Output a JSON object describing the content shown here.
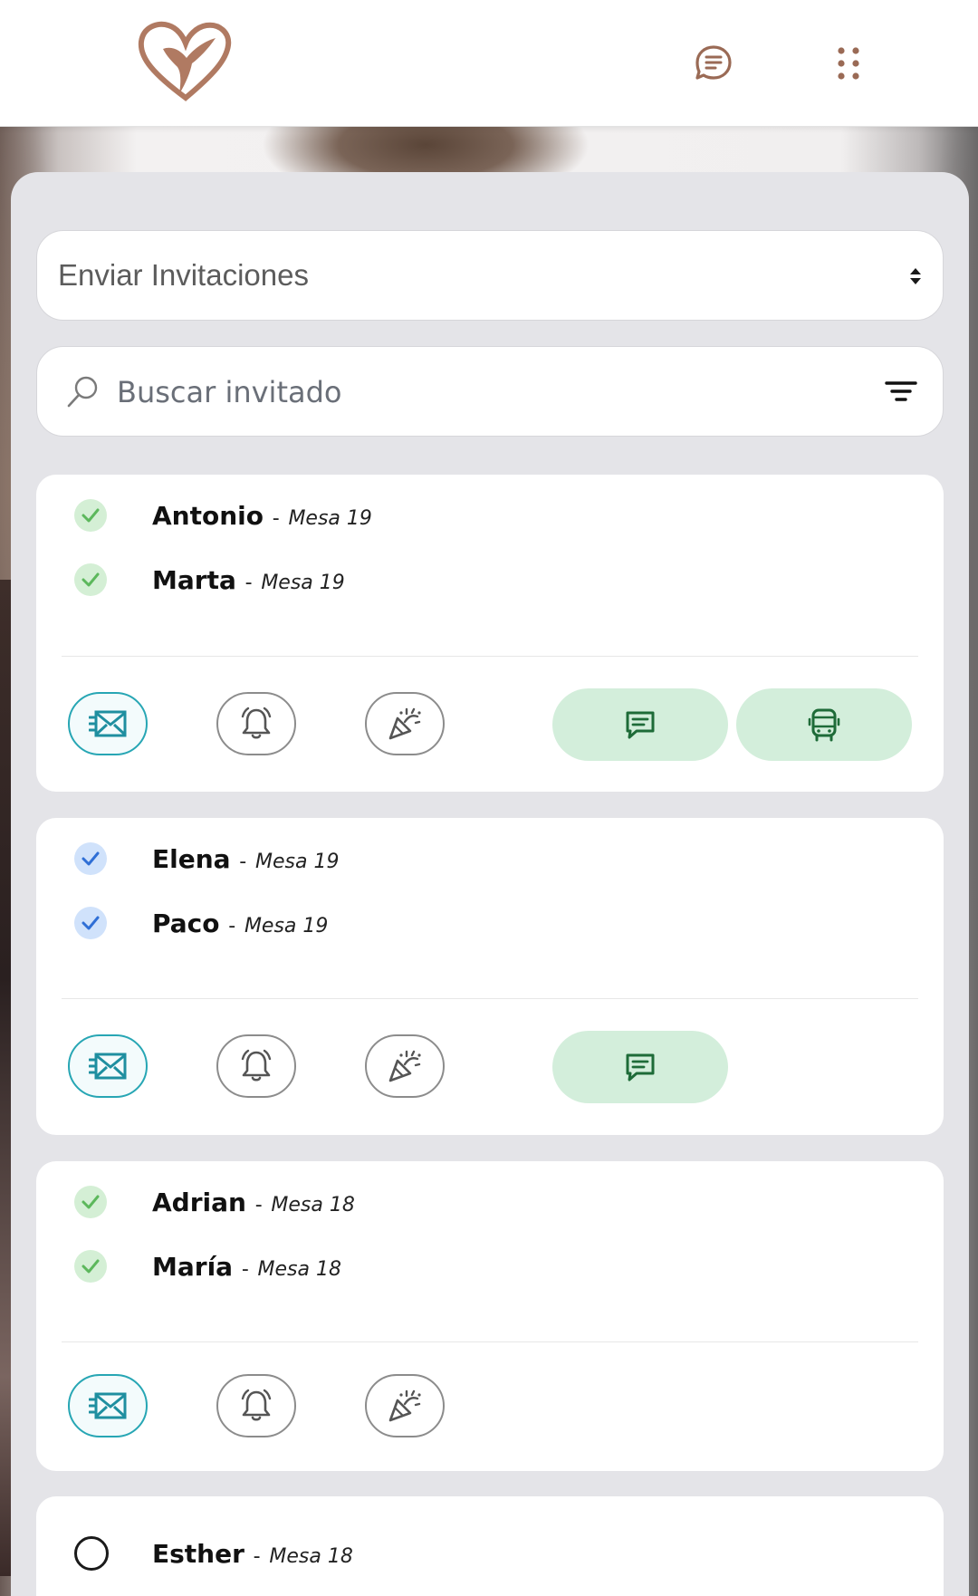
{
  "header": {
    "logo_icon": "heart-hummingbird-logo",
    "chat_icon": "chat-bubble-icon",
    "menu_icon": "grid-dots-icon",
    "brand_color": "#b07a62"
  },
  "action_select": {
    "value": "Enviar Invitaciones"
  },
  "search": {
    "placeholder": "Buscar invitado",
    "filter_icon": "filter-icon"
  },
  "groups": [
    {
      "guests": [
        {
          "name": "Antonio",
          "separator": "-",
          "table": "Mesa 19",
          "status": "green-check"
        },
        {
          "name": "Marta",
          "separator": "-",
          "table": "Mesa 19",
          "status": "green-check"
        }
      ],
      "actions": [
        "send-invitation",
        "reminder",
        "celebration",
        "message",
        "bus"
      ]
    },
    {
      "guests": [
        {
          "name": "Elena",
          "separator": "-",
          "table": "Mesa 19",
          "status": "blue-check"
        },
        {
          "name": "Paco",
          "separator": "-",
          "table": "Mesa 19",
          "status": "blue-check"
        }
      ],
      "actions": [
        "send-invitation",
        "reminder",
        "celebration",
        "message"
      ]
    },
    {
      "guests": [
        {
          "name": "Adrian",
          "separator": "-",
          "table": "Mesa 18",
          "status": "green-check"
        },
        {
          "name": "María",
          "separator": "-",
          "table": "Mesa 18",
          "status": "green-check"
        }
      ],
      "actions": [
        "send-invitation",
        "reminder",
        "celebration"
      ]
    },
    {
      "guests": [
        {
          "name": "Esther",
          "separator": "-",
          "table": "Mesa 18",
          "status": "empty"
        }
      ],
      "actions": []
    }
  ],
  "colors": {
    "green_check_bg": "#d4efd5",
    "green_check": "#5cb85c",
    "blue_check_bg": "#d0e2fb",
    "blue_check": "#2f6fd6",
    "mail_accent": "#27a6b4",
    "pill_bg": "#d3eedb",
    "pill_icon": "#1e6b38"
  }
}
